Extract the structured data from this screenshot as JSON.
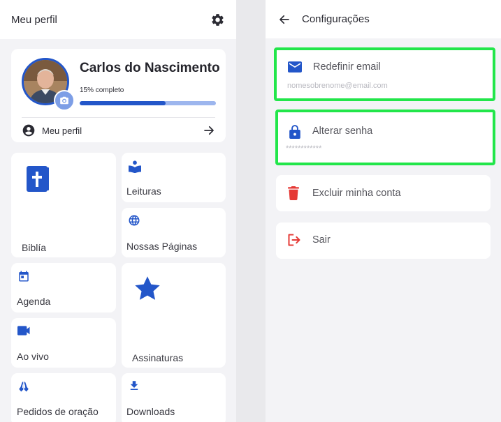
{
  "left_screen": {
    "header": {
      "title": "Meu perfil",
      "settings_icon": "gear-icon"
    },
    "profile": {
      "name": "Carlos do Nascimento",
      "progress_label": "15% completo",
      "progress_fraction": 0.63,
      "link_label": "Meu perfil"
    },
    "tiles": {
      "biblia": "Biblía",
      "leituras": "Leituras",
      "nossas_paginas": "Nossas Páginas",
      "agenda": "Agenda",
      "assinaturas": "Assinaturas",
      "ao_vivo": "Ao vivo",
      "pedidos": "Pedidos de oração",
      "downloads": "Downloads"
    }
  },
  "right_screen": {
    "header": {
      "title": "Configurações"
    },
    "settings": {
      "email_label": "Redefinir email",
      "email_value": "nomesobrenome@email.com",
      "password_label": "Alterar senha",
      "password_value": "************",
      "delete_label": "Excluir minha conta",
      "logout_label": "Sair"
    }
  },
  "colors": {
    "accent": "#2356c9",
    "accent_light": "#9db6ee",
    "danger": "#e53935",
    "highlight": "#22e64a",
    "background": "#f3f3f6"
  }
}
